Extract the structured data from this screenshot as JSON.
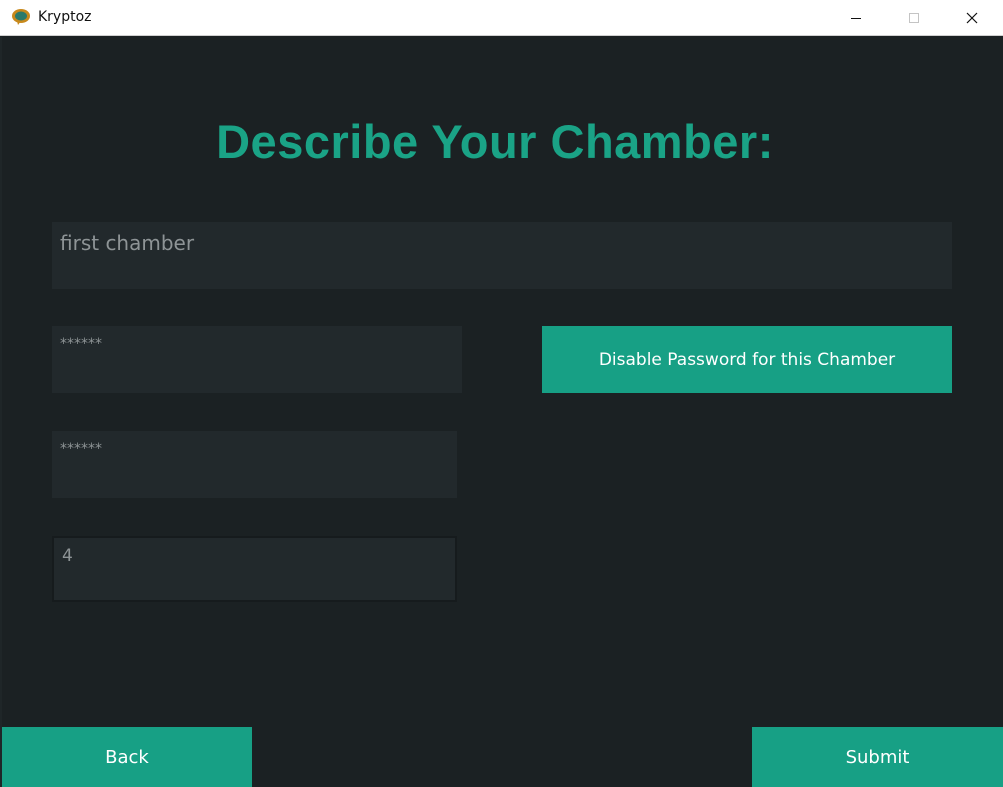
{
  "window": {
    "title": "Kryptoz",
    "icon": "kryptoz-app-icon",
    "controls": [
      "minimize-icon",
      "maximize-icon",
      "close-icon"
    ]
  },
  "heading": "Describe Your Chamber:",
  "form": {
    "chamber_name_value": "first chamber",
    "password_value": "******",
    "confirm_password_value": "******",
    "count_value": "4"
  },
  "buttons": {
    "disable_password": "Disable Password for this Chamber",
    "back": "Back",
    "submit": "Submit"
  },
  "colors": {
    "background": "#1b2123",
    "field_background": "#22292c",
    "accent": "#17a085",
    "heading": "#1aa386"
  }
}
